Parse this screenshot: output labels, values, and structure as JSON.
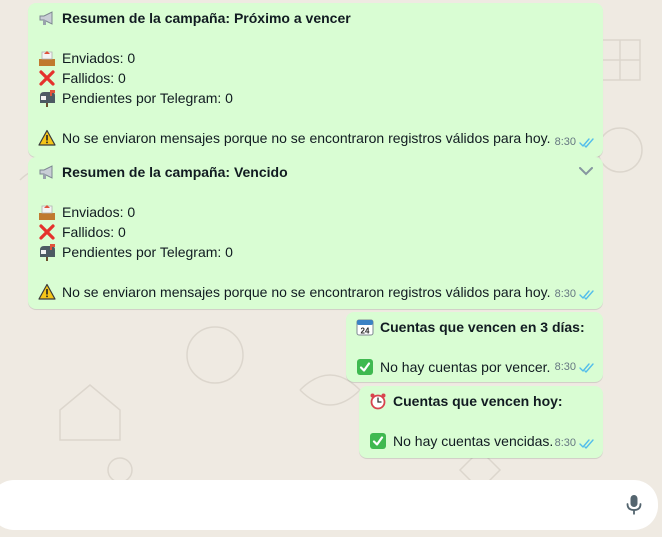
{
  "messages": [
    {
      "title": "Resumen de la campaña: Próximo a vencer",
      "sent": "Enviados: 0",
      "failed": "Fallidos: 0",
      "pending": "Pendientes por Telegram: 0",
      "warning": "No se enviaron mensajes porque no se encontraron registros válidos para hoy.",
      "time": "8:30"
    },
    {
      "title": "Resumen de la campaña: Vencido",
      "sent": "Enviados: 0",
      "failed": "Fallidos: 0",
      "pending": "Pendientes por Telegram: 0",
      "warning": "No se enviaron mensajes porque no se encontraron registros válidos para hoy.",
      "time": "8:30"
    },
    {
      "title": "Cuentas que vencen en 3 días:",
      "body": "No hay cuentas por vencer.",
      "time": "8:30"
    },
    {
      "title": "Cuentas que vencen hoy:",
      "body": "No hay cuentas vencidas.",
      "time": "8:30"
    }
  ],
  "colors": {
    "bubble": "#d9fdd3",
    "background": "#efeae2",
    "read_ticks": "#53bdeb",
    "meta_text": "#667781"
  },
  "icons": {
    "megaphone": "megaphone-icon",
    "outbox": "outbox-tray-icon",
    "cross": "cross-mark-icon",
    "mailbox": "mailbox-icon",
    "warning": "warning-icon",
    "calendar": "calendar-icon",
    "alarm": "alarm-clock-icon",
    "check": "check-mark-button-icon",
    "mic": "microphone-icon"
  }
}
